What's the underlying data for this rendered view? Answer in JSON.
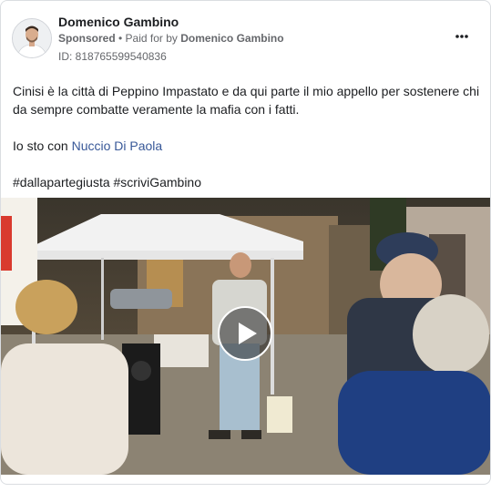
{
  "post": {
    "author": "Domenico Gambino",
    "sponsored": "Sponsored",
    "paid_for_prefix": " • Paid for by ",
    "paid_for_by": "Domenico Gambino",
    "ad_id": "ID: 818765599540836",
    "text_line1": "Cinisi è la città di Peppino Impastato e da qui parte il mio appello per sostenere chi da sempre combatte veramente la mafia con i fatti.",
    "text_line2_prefix": "Io sto con ",
    "text_line2_link": "Nuccio Di Paola",
    "hashtags": "#dallapartegiusta #scriviGambino"
  },
  "icons": {
    "more": "more-horizontal-icon",
    "play": "play-icon"
  },
  "colors": {
    "link": "#385898",
    "secondary_text": "#65676b",
    "border": "#dadde1"
  }
}
